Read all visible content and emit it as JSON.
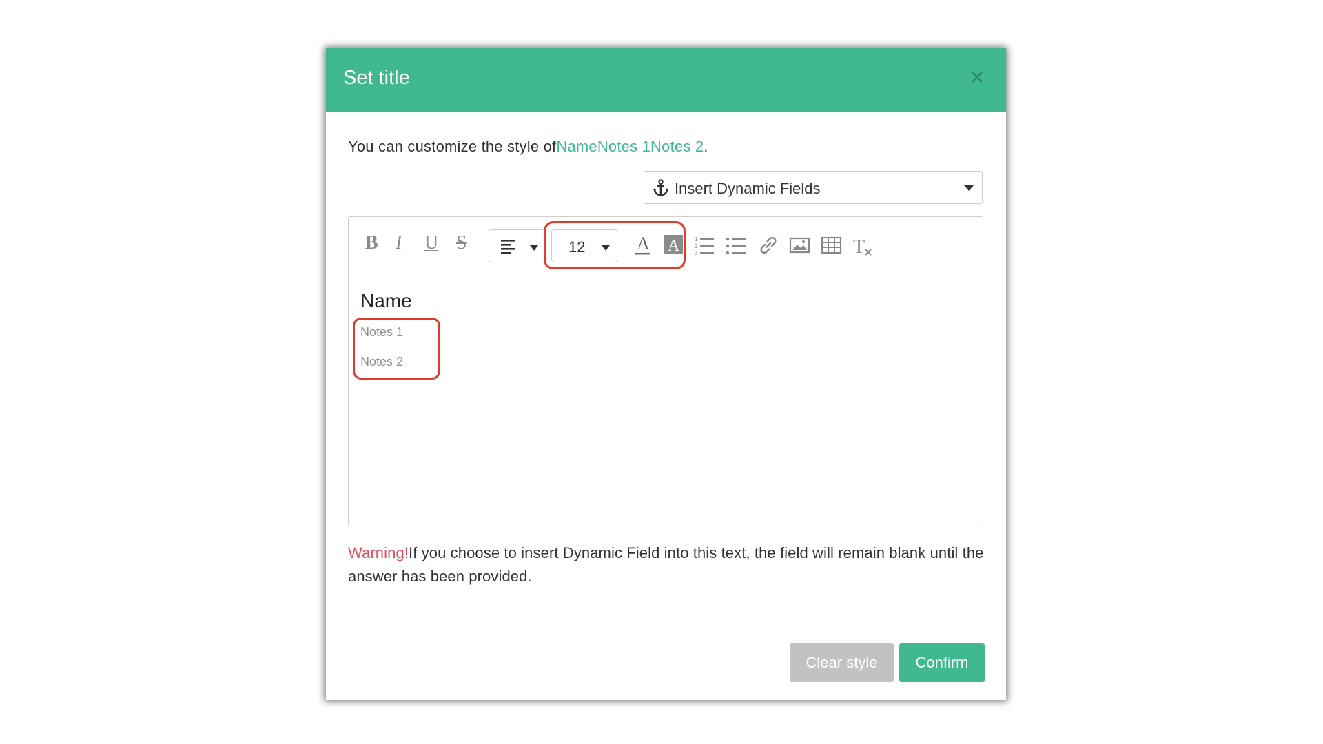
{
  "dialog": {
    "title": "Set title",
    "close_icon": "close-icon"
  },
  "description": {
    "prefix": "You can customize the style of",
    "fields_text": "NameNotes 1Notes 2",
    "suffix": "."
  },
  "dynamic_fields": {
    "label": "Insert Dynamic Fields",
    "icon": "anchor-icon"
  },
  "toolbar": {
    "bold": "B",
    "italic": "I",
    "underline": "U",
    "strike": "S",
    "font_size": "12",
    "font_color_glyph": "A",
    "bg_color_glyph": "A",
    "clear_format_glyph": "T"
  },
  "editor_content": {
    "name": "Name",
    "notes_1": "Notes 1",
    "notes_2": "Notes 2"
  },
  "warning": {
    "label": "Warning!",
    "text": "If you choose to insert Dynamic Field into this text, the field will remain blank until the answer has been provided."
  },
  "buttons": {
    "clear_style": "Clear style",
    "confirm": "Confirm"
  },
  "colors": {
    "accent": "#40b98f",
    "warning": "#e74c5c",
    "highlight": "#e23b2a",
    "disabled_button": "#c2c2c2"
  }
}
